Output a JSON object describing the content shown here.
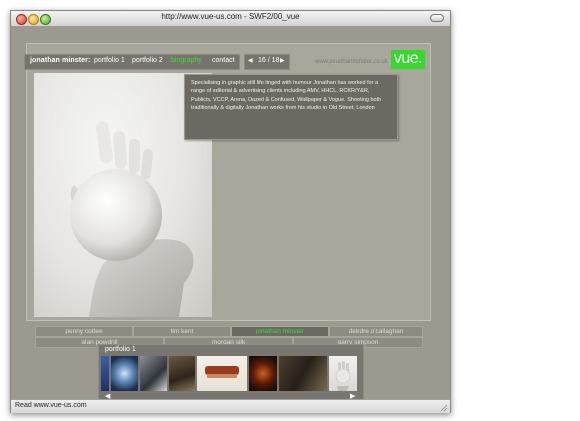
{
  "window": {
    "title": "http://www.vue-us.com - SWF2/00_vue"
  },
  "nav": {
    "name": "jonathan minster:",
    "items": [
      "portfolio 1",
      "portfolio 2",
      "biography",
      "contact"
    ],
    "active": "biography"
  },
  "counter": {
    "text": "16 / 18",
    "prev_icon": "triangle-left-icon",
    "next_icon": "triangle-right-icon"
  },
  "site_url": "www.jonathanminster.co.uk",
  "logo": "vue.",
  "biography": "Specialising in graphic still life tinged with humour Jonathan has worked for a range of editorial & advertising clients including AMV, HHCL, RCKR/Y&R, Publicis, VCCP, Arena, Dazed & Confused, Wallpaper & Vogue. Shooting both traditionally & digitally Jonathan works from his studio in Old Street, London",
  "photographers": {
    "row1": [
      "penny cottee",
      "tim kent",
      "jonathan minster",
      "deirdre o'callaghan"
    ],
    "row2": [
      "alan powdrill",
      "morgan silk",
      "garry simpson"
    ],
    "active": "jonathan minster"
  },
  "thumbnails": {
    "title": "portfolio 1",
    "count": 7,
    "prev_icon": "arrow-left-icon",
    "next_icon": "arrow-right-icon"
  },
  "status": {
    "text": "Read www.vue-us.com"
  },
  "colors": {
    "accent": "#2ee23a",
    "logo_bg": "#33d92b",
    "panel": "#77746c",
    "background": "#9c998f"
  }
}
